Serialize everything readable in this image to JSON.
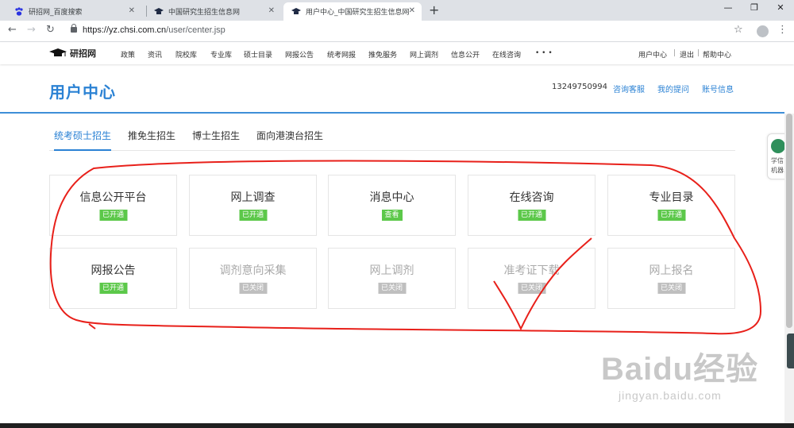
{
  "browser": {
    "tabs": [
      {
        "title": "研招网_百度搜索",
        "active": false
      },
      {
        "title": "中国研究生招生信息网",
        "active": false
      },
      {
        "title": "用户中心_中国研究生招生信息网",
        "active": true
      }
    ],
    "url": {
      "host": "https://yz.chsi.com.cn",
      "path": "/user/center.jsp"
    }
  },
  "site_nav": {
    "logo_text": "研招网",
    "items": [
      "政策",
      "资讯",
      "院校库",
      "专业库",
      "硕士目录",
      "网报公告",
      "统考网报",
      "推免服务",
      "网上调剂",
      "信息公开",
      "在线咨询"
    ],
    "more": "• • •",
    "right": [
      "用户中心",
      "|",
      "退出",
      "|",
      "帮助中心"
    ]
  },
  "header": {
    "title": "用户中心",
    "phone": "13249750994",
    "links": [
      "咨询客服",
      "我的提问",
      "账号信息"
    ]
  },
  "subtabs": [
    {
      "label": "统考硕士招生",
      "active": true
    },
    {
      "label": "推免生招生",
      "active": false
    },
    {
      "label": "博士生招生",
      "active": false
    },
    {
      "label": "面向港澳台招生",
      "active": false
    }
  ],
  "cards": [
    {
      "title": "信息公开平台",
      "status": "已开通",
      "enabled": true
    },
    {
      "title": "网上调查",
      "status": "已开通",
      "enabled": true
    },
    {
      "title": "消息中心",
      "status": "查看",
      "enabled": true
    },
    {
      "title": "在线咨询",
      "status": "已开通",
      "enabled": true
    },
    {
      "title": "专业目录",
      "status": "已开通",
      "enabled": true
    },
    {
      "title": "网报公告",
      "status": "已开通",
      "enabled": true
    },
    {
      "title": "调剂意向采集",
      "status": "已关闭",
      "enabled": false
    },
    {
      "title": "网上调剂",
      "status": "已关闭",
      "enabled": false
    },
    {
      "title": "准考证下载",
      "status": "已关闭",
      "enabled": false
    },
    {
      "title": "网上报名",
      "status": "已关闭",
      "enabled": false
    }
  ],
  "widget": {
    "line1": "学信",
    "line2": "机器."
  },
  "watermark": {
    "brand": "Baidu经验",
    "url": "jingyan.baidu.com"
  },
  "colors": {
    "accent": "#2b82d4",
    "status_open": "#5cc84a",
    "status_closed": "#bfbfbf",
    "annotation": "#e8201a"
  }
}
